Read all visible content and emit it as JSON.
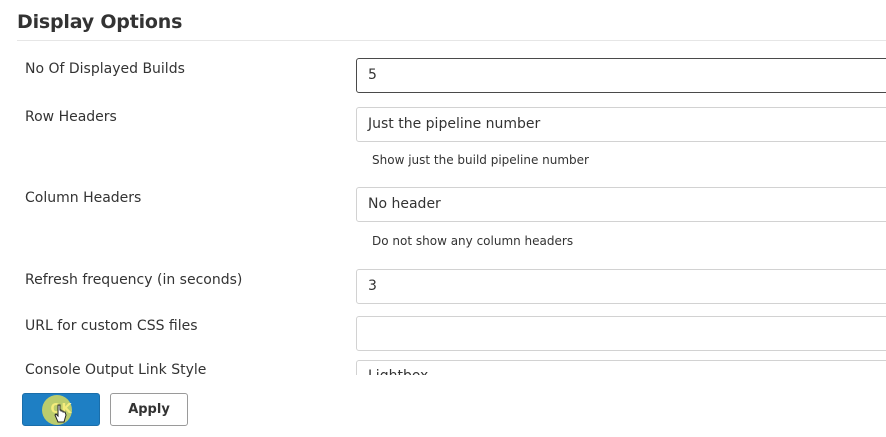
{
  "section": {
    "title": "Display Options"
  },
  "rows": [
    {
      "label": "No Of Displayed Builds",
      "value": "5"
    },
    {
      "label": "Row Headers",
      "value": "Just the pipeline number",
      "help": "Show just the build pipeline number"
    },
    {
      "label": "Column Headers",
      "value": "No header",
      "help": "Do not show any column headers"
    },
    {
      "label": "Refresh frequency (in seconds)",
      "value": "3"
    },
    {
      "label": "URL for custom CSS files",
      "value": ""
    },
    {
      "label": "Console Output Link Style",
      "value": "Lightbox"
    }
  ],
  "buttons": {
    "ok": "OK",
    "apply": "Apply"
  },
  "colors": {
    "primary": "#1e7fc4",
    "border": "#d2d2d2"
  }
}
